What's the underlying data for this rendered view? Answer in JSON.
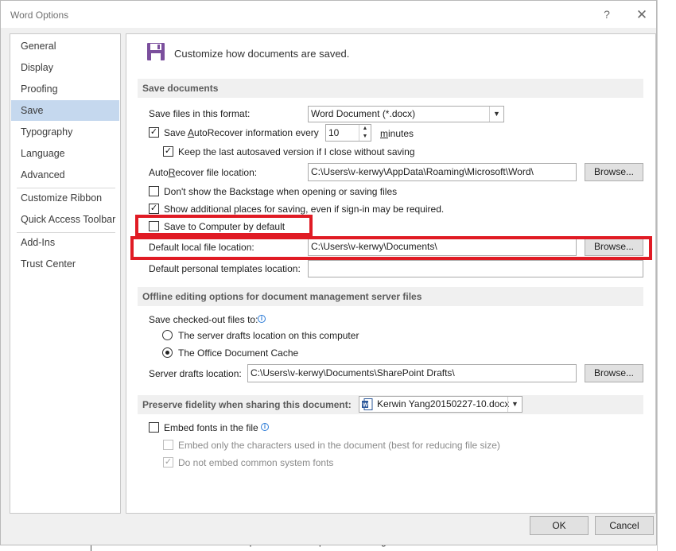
{
  "window": {
    "title": "Word Options",
    "help_glyph": "?",
    "close_glyph": "✕"
  },
  "background_text": "Customer's Expected Result : -push something out to force clients to have to re-enter their",
  "nav": {
    "items": [
      {
        "label": "General"
      },
      {
        "label": "Display"
      },
      {
        "label": "Proofing"
      },
      {
        "label": "Save",
        "selected": true
      },
      {
        "label": "Typography"
      },
      {
        "label": "Language"
      },
      {
        "label": "Advanced"
      },
      {
        "label": "Customize Ribbon"
      },
      {
        "label": "Quick Access Toolbar"
      },
      {
        "label": "Add-Ins"
      },
      {
        "label": "Trust Center"
      }
    ]
  },
  "header": {
    "text": "Customize how documents are saved.",
    "icon": "floppy-disk-icon",
    "icon_color": "#7b4f9d"
  },
  "save_documents": {
    "title": "Save documents",
    "format_label": "Save files in this format:",
    "format_value": "Word Document (*.docx)",
    "autorecover_label": "Save AutoRecover information every",
    "autorecover_value": "10",
    "minutes_label": "minutes",
    "keep_last_label": "Keep the last autosaved version if I close without saving",
    "autorecover_location_label": "AutoRecover file location:",
    "autorecover_location_value": "C:\\Users\\v-kerwy\\AppData\\Roaming\\Microsoft\\Word\\",
    "browse_label": "Browse...",
    "dont_show_backstage_label": "Don't show the Backstage when opening or saving files",
    "show_additional_label": "Show additional places for saving, even if sign-in may be required.",
    "save_to_computer_label": "Save to Computer by default",
    "default_local_label": "Default local file location:",
    "default_local_value": "C:\\Users\\v-kerwy\\Documents\\",
    "default_personal_label": "Default personal templates location:",
    "default_personal_value": "",
    "checked": {
      "autorecover": true,
      "keep_last": true,
      "dont_show_backstage": false,
      "show_additional": true,
      "save_to_computer": false
    }
  },
  "offline": {
    "title": "Offline editing options for document management server files",
    "checked_out_label": "Save checked-out files to:",
    "radio_server": "The server drafts location on this computer",
    "radio_cache": "The Office Document Cache",
    "selected_radio": "cache",
    "server_drafts_label": "Server drafts location:",
    "server_drafts_value": "C:\\Users\\v-kerwy\\Documents\\SharePoint Drafts\\",
    "browse_label": "Browse..."
  },
  "fidelity": {
    "title": "Preserve fidelity when sharing this document:",
    "document_value": "Kerwin Yang20150227-10.docx",
    "embed_fonts_label": "Embed fonts in the file",
    "embed_only_label": "Embed only the characters used in the document (best for reducing file size)",
    "do_not_embed_label": "Do not embed common system fonts",
    "checked": {
      "embed_fonts": false,
      "embed_only": false,
      "do_not_embed": true
    }
  },
  "footer": {
    "ok_label": "OK",
    "cancel_label": "Cancel"
  },
  "annotation_color": "#e01b24"
}
